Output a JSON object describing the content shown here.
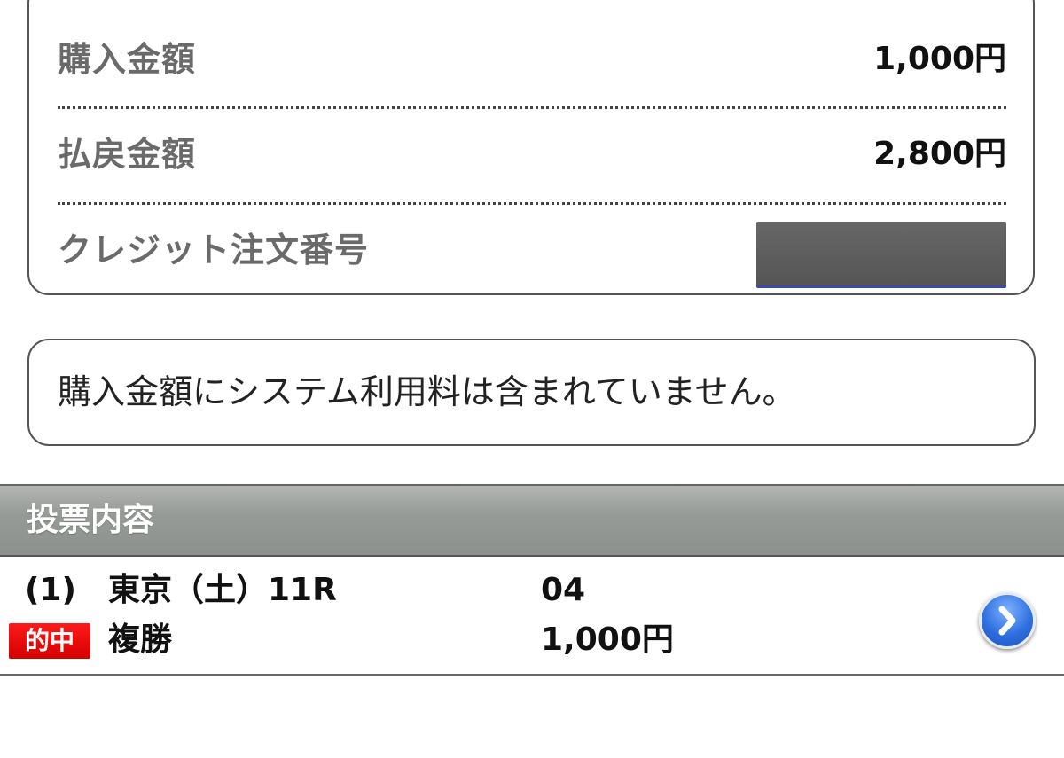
{
  "summary": {
    "purchase_label": "購入金額",
    "purchase_value": "1,000円",
    "payout_label": "払戻金額",
    "payout_value": "2,800円",
    "credit_label": "クレジット注文番号"
  },
  "notice": {
    "text": "購入金額にシステム利用料は含まれていません。"
  },
  "section": {
    "title": "投票内容"
  },
  "bet": {
    "index": "(1)",
    "race": "東京（土）11R",
    "horse_number": "04",
    "badge": "的中",
    "type": "複勝",
    "amount": "1,000円",
    "detail_icon": "chevron-right-icon"
  },
  "colors": {
    "badge_red": "#e00000",
    "header_gray": "#979b97",
    "button_blue": "#2f6fe0"
  }
}
